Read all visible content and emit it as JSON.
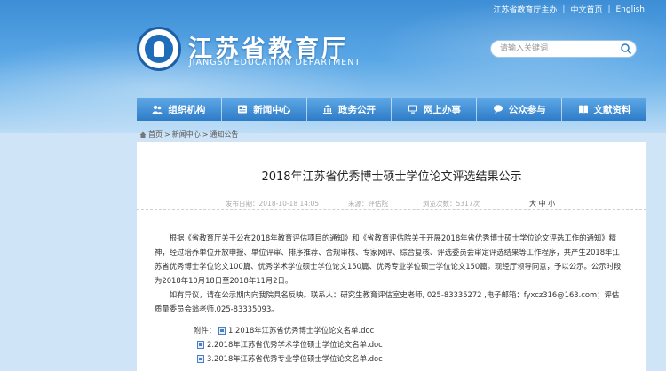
{
  "top_links": [
    "江苏省教育厅主办",
    "中文首页",
    "English"
  ],
  "header": {
    "title": "江苏省教育厅",
    "subtitle": "JIANGSU EDUCATION DEPARTMENT"
  },
  "search": {
    "placeholder": "请输入关键词"
  },
  "nav": [
    {
      "label": "组织机构",
      "icon": "people-icon"
    },
    {
      "label": "新闻中心",
      "icon": "newspaper-icon"
    },
    {
      "label": "政务公开",
      "icon": "government-icon"
    },
    {
      "label": "网上办事",
      "icon": "computer-icon"
    },
    {
      "label": "公众参与",
      "icon": "chat-icon"
    },
    {
      "label": "文献资料",
      "icon": "book-icon"
    }
  ],
  "breadcrumb": [
    "首页",
    "新闻中心",
    "通知公告"
  ],
  "article": {
    "title": "2018年江苏省优秀博士硕士学位论文评选结果公示",
    "publish_time": "发布日期：2018-10-18 14:05",
    "source": "来源：评估院",
    "views": "浏览次数：5317次",
    "font_size": "大 中 小",
    "para1": "根据《省教育厅关于公布2018年教育评估项目的通知》和《省教育评估院关于开展2018年省优秀博士硕士学位论文评选工作的通知》精神，经过培养单位开放申报、单位评审、排序推荐、合规审核、专家网评、综合复核、评选委员会审定评选结果等工作程序，共产生2018年江苏省优秀博士学位论文100篇、优秀学术学位硕士学位论文150篇、优秀专业学位硕士学位论文150篇。现经厅领导同意，予以公示。公示时段为2018年10月18日至2018年11月2日。",
    "para2": "如有异议，请在公示期内向我院具名反映。联系人：研究生教育评估室史老师, 025-83335272 ,电子邮箱：fyxcz316@163.com；评估质量委员会翁老师,025-83335093。",
    "attach_label": "附件：",
    "attachments": [
      "1.2018年江苏省优秀博士学位论文名单.doc",
      "2.2018年江苏省优秀学术学位硕士学位论文名单.doc",
      "3.2018年江苏省优秀专业学位硕士学位论文名单.doc"
    ]
  }
}
